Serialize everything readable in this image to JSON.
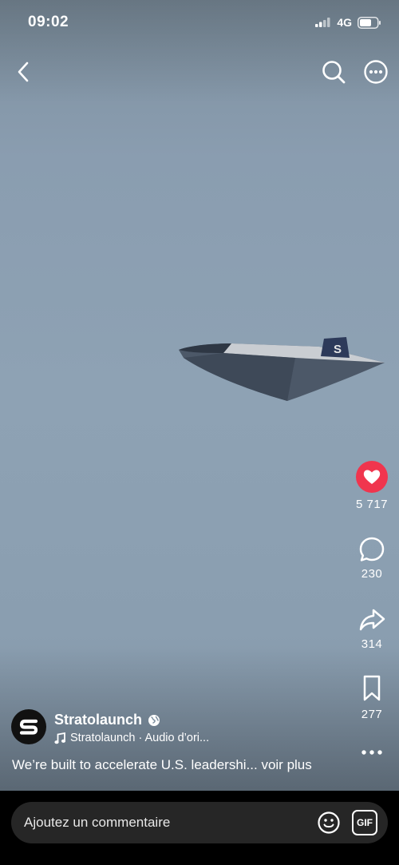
{
  "status_bar": {
    "time": "09:02",
    "network": "4G"
  },
  "top_nav": {
    "back_icon": "chevron-left-icon",
    "search_icon": "search-icon",
    "more_icon": "more-circle-icon"
  },
  "video": {
    "subject": "aircraft-image",
    "tail_logo": "S"
  },
  "action_rail": {
    "like": {
      "icon": "heart-icon",
      "count": "5 717",
      "color": "#fe2c55"
    },
    "comment": {
      "icon": "comment-icon",
      "count": "230"
    },
    "share": {
      "icon": "share-icon",
      "count": "314"
    },
    "save": {
      "icon": "bookmark-icon",
      "count": "277"
    },
    "more_icon": "more-horizontal-icon"
  },
  "post": {
    "username": "Stratolaunch",
    "audio": "Stratolaunch · Audio d’ori...",
    "caption": "We’re built to accelerate U.S. leadershi...",
    "see_more": "voir plus"
  },
  "comment_bar": {
    "placeholder": "Ajoutez un commentaire",
    "emoji_icon": "emoji-icon",
    "gif_label": "GIF"
  }
}
